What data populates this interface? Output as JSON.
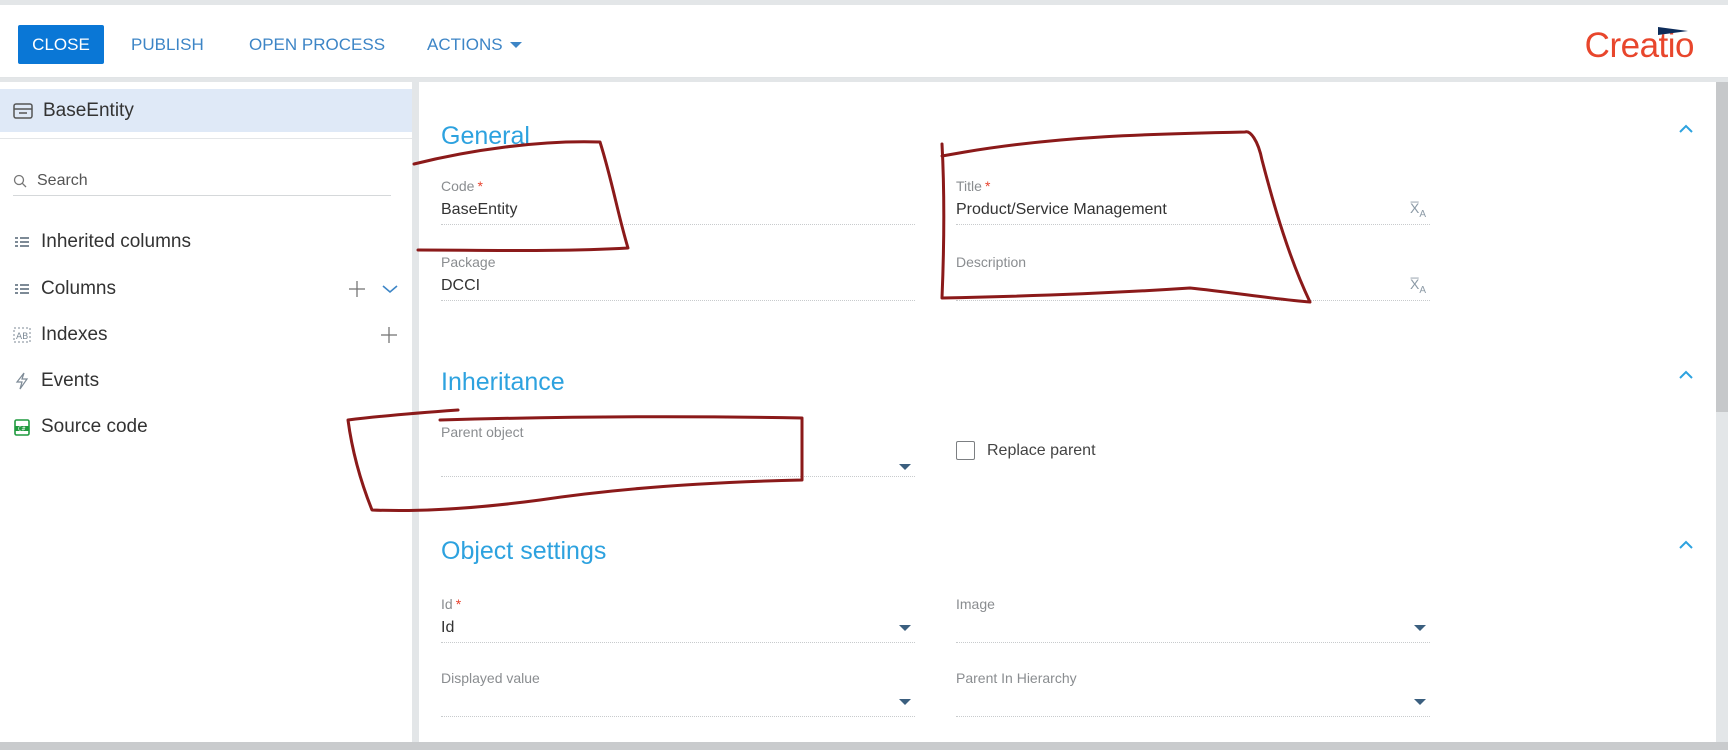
{
  "toolbar": {
    "close_label": "CLOSE",
    "publish_label": "PUBLISH",
    "open_process_label": "OPEN PROCESS",
    "actions_label": "ACTIONS"
  },
  "logo": {
    "text": "Creatio",
    "color": "#e8462c"
  },
  "sidebar": {
    "header": {
      "label": "BaseEntity",
      "icon": "table-icon"
    },
    "search": {
      "placeholder": "Search",
      "value": ""
    },
    "items": [
      {
        "label": "Inherited columns",
        "icon": "columns-icon"
      },
      {
        "label": "Columns",
        "icon": "columns-icon"
      },
      {
        "label": "Indexes",
        "icon": "index-icon"
      },
      {
        "label": "Events",
        "icon": "lightning-icon"
      },
      {
        "label": "Source code",
        "icon": "source-code-icon"
      }
    ]
  },
  "main": {
    "general": {
      "title": "General",
      "code": {
        "label": "Code",
        "required": "*",
        "value": "BaseEntity"
      },
      "title_field": {
        "label": "Title",
        "required": "*",
        "value": "Product/Service Management"
      },
      "package": {
        "label": "Package",
        "value": "DCCI"
      },
      "description": {
        "label": "Description",
        "value": ""
      }
    },
    "inheritance": {
      "title": "Inheritance",
      "parent_object": {
        "label": "Parent object",
        "value": ""
      },
      "replace_parent": {
        "label": "Replace parent",
        "checked": false
      }
    },
    "object_settings": {
      "title": "Object settings",
      "id": {
        "label": "Id",
        "required": "*",
        "value": "Id"
      },
      "image": {
        "label": "Image",
        "value": ""
      },
      "displayed_value": {
        "label": "Displayed value",
        "value": ""
      },
      "parent_in_hierarchy": {
        "label": "Parent In Hierarchy",
        "value": ""
      }
    }
  },
  "colors": {
    "accent_blue": "#0a77d6",
    "section_title": "#2da2df",
    "required": "#e8432e",
    "annotation": "#8b1a1a"
  }
}
